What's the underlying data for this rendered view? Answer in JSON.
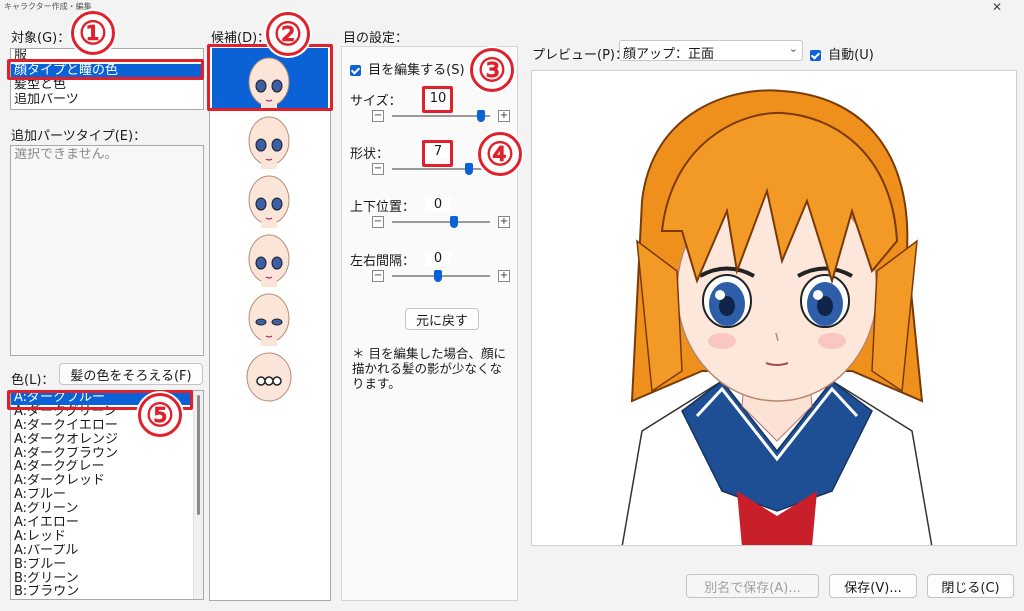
{
  "window": {
    "title": "キャラクター作成・編集",
    "close_glyph": "✕"
  },
  "target": {
    "label": "対象(G)：",
    "items": [
      "服",
      "顔タイプと瞳の色",
      "髪型と色",
      "追加パーツ"
    ],
    "selected_index": 1
  },
  "extra_parts": {
    "label": "追加パーツタイプ(E)：",
    "placeholder": "選択できません。"
  },
  "color": {
    "label": "色(L)：",
    "match_button": "髪の色をそろえる(F)",
    "items": [
      "A:ダークブルー",
      "A:ダークグリーン",
      "A:ダークイエロー",
      "A:ダークオレンジ",
      "A:ダークブラウン",
      "A:ダークグレー",
      "A:ダークレッド",
      "A:ブルー",
      "A:グリーン",
      "A:イエロー",
      "A:レッド",
      "A:パープル",
      "B:ブルー",
      "B:グリーン",
      "B:ブラウン"
    ],
    "selected_index": 0
  },
  "candidates": {
    "label": "候補(D)：",
    "count": 6,
    "selected_index": 0
  },
  "eye_settings": {
    "label": "目の設定：",
    "edit_checkbox": "目を編集する(S)",
    "edit_checked": true,
    "sliders": [
      {
        "label": "サイズ：",
        "value": "10",
        "fraction": 0.9
      },
      {
        "label": "形状：",
        "value": "7",
        "fraction": 0.78
      },
      {
        "label": "上下位置：",
        "value": "0",
        "fraction": 0.62
      },
      {
        "label": "左右間隔：",
        "value": "0",
        "fraction": 0.45
      }
    ],
    "reset_button": "元に戻す",
    "note": "＊ 目を編集した場合、顔に描かれる髪の影が少なくなります。"
  },
  "preview": {
    "label": "プレビュー(P)：",
    "select_value": "顔アップ：正面",
    "auto_label": "自動(U)",
    "auto_checked": true
  },
  "footer": {
    "save_as": "別名で保存(A)...",
    "save": "保存(V)...",
    "close": "閉じる(C)"
  },
  "callouts": [
    "①",
    "②",
    "③",
    "④",
    "⑤"
  ],
  "colors": {
    "accent": "#0a62d6",
    "highlight": "#e0202a",
    "hair": "#f0901c",
    "uniform": "#1e4f95",
    "eyes": "#2f5ea8"
  }
}
